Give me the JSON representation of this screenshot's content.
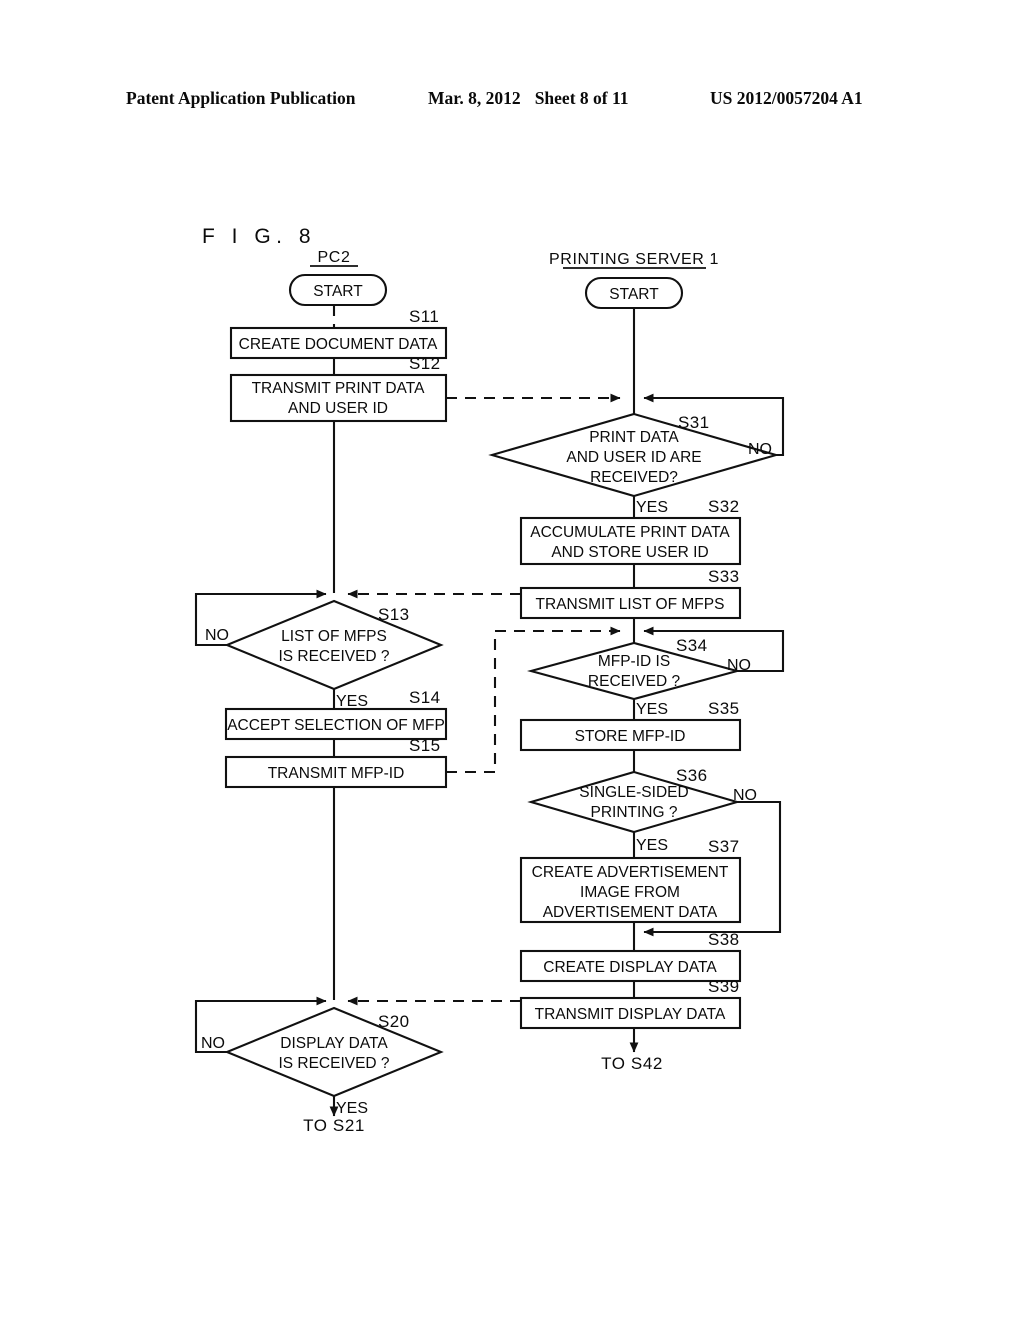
{
  "header": {
    "left": "Patent Application Publication",
    "date": "Mar. 8, 2012",
    "sheet": "Sheet 8 of 11",
    "pub_number": "US 2012/0057204 A1"
  },
  "figure": {
    "label": "F I G.  8"
  },
  "columns": {
    "left": "PC2",
    "right": "PRINTING SERVER 1"
  },
  "terminals": {
    "left_start": "START",
    "right_start": "START",
    "left_exit": "TO S21",
    "right_exit": "TO S42"
  },
  "labels": {
    "yes": "YES",
    "no": "NO"
  },
  "left_flow": [
    {
      "step": "S11",
      "type": "process",
      "lines": [
        "CREATE DOCUMENT DATA"
      ]
    },
    {
      "step": "S12",
      "type": "process",
      "lines": [
        "TRANSMIT PRINT DATA",
        "AND USER ID"
      ]
    },
    {
      "step": "S13",
      "type": "decision",
      "lines": [
        "LIST OF MFPS",
        "IS RECEIVED ?"
      ],
      "yes": "YES",
      "no": "NO"
    },
    {
      "step": "S14",
      "type": "process",
      "lines": [
        "ACCEPT SELECTION OF MFP"
      ]
    },
    {
      "step": "S15",
      "type": "process",
      "lines": [
        "TRANSMIT MFP-ID"
      ]
    },
    {
      "step": "S20",
      "type": "decision",
      "lines": [
        "DISPLAY DATA",
        "IS RECEIVED ?"
      ],
      "yes": "YES",
      "no": "NO"
    }
  ],
  "right_flow": [
    {
      "step": "S31",
      "type": "decision",
      "lines": [
        "PRINT DATA",
        "AND USER ID ARE",
        "RECEIVED?"
      ],
      "yes": "YES",
      "no": "NO"
    },
    {
      "step": "S32",
      "type": "process",
      "lines": [
        "ACCUMULATE PRINT DATA",
        "AND STORE USER ID"
      ]
    },
    {
      "step": "S33",
      "type": "process",
      "lines": [
        "TRANSMIT LIST OF MFPS"
      ]
    },
    {
      "step": "S34",
      "type": "decision",
      "lines": [
        "MFP-ID IS",
        "RECEIVED ?"
      ],
      "yes": "YES",
      "no": "NO"
    },
    {
      "step": "S35",
      "type": "process",
      "lines": [
        "STORE MFP-ID"
      ]
    },
    {
      "step": "S36",
      "type": "decision",
      "lines": [
        "SINGLE-SIDED",
        "PRINTING ?"
      ],
      "yes": "YES",
      "no": "NO"
    },
    {
      "step": "S37",
      "type": "process",
      "lines": [
        "CREATE ADVERTISEMENT",
        "IMAGE FROM",
        "ADVERTISEMENT DATA"
      ]
    },
    {
      "step": "S38",
      "type": "process",
      "lines": [
        "CREATE DISPLAY DATA"
      ]
    },
    {
      "step": "S39",
      "type": "process",
      "lines": [
        "TRANSMIT DISPLAY DATA"
      ]
    }
  ]
}
